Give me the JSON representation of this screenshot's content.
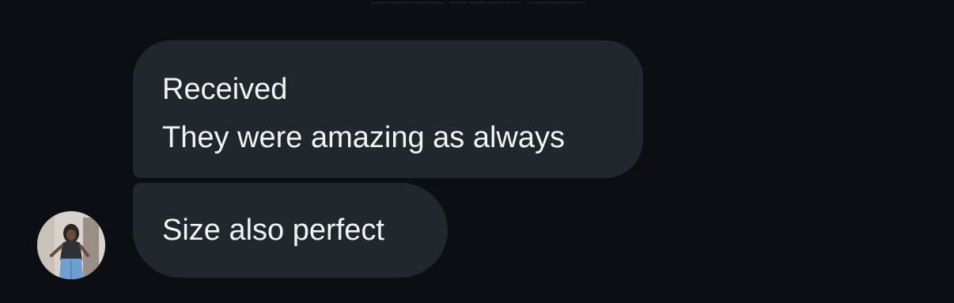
{
  "messages": [
    {
      "lines": [
        "Received",
        "They were amazing as always"
      ]
    },
    {
      "lines": [
        "Size also perfect"
      ]
    }
  ],
  "avatar": {
    "icon": "user-photo-icon"
  },
  "colors": {
    "background": "#0b0f14",
    "bubble": "#22272e",
    "text": "#f2f3f5"
  }
}
